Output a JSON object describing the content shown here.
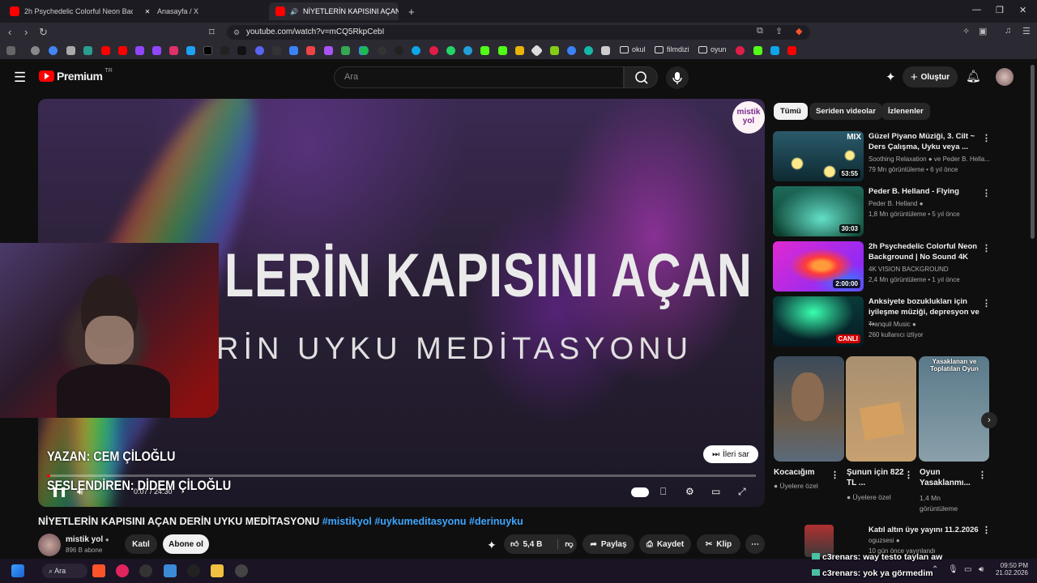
{
  "browser": {
    "tabs": [
      {
        "label": "2h Psychedelic Colorful Neon Backg",
        "icon": "youtube-icon"
      },
      {
        "label": "Anasayfa / X",
        "icon": "x-icon"
      },
      {
        "label": "NİYETLERİN KAPISINI AÇAN D",
        "icon": "youtube-icon"
      }
    ],
    "new_tab": "+",
    "url": "youtube.com/watch?v=mCQ5RkpCebI",
    "bookmark_folders": [
      "okul",
      "filmdizi",
      "oyun"
    ]
  },
  "header": {
    "logo_text": "Premium",
    "logo_sup": "TR",
    "search_placeholder": "Ara",
    "create_label": "Oluştur"
  },
  "player": {
    "big_title": "LERİN KAPISINI AÇAN",
    "big_subtitle": "RİN UYKU MEDİTASYONU",
    "author": "YAZAN: CEM ÇİLOĞLU",
    "voice": "SESLENDİREN: DİDEM ÇİLOĞLU",
    "channel_logo": "mistik yol",
    "skip_label": "İleri sar",
    "time": "0:07 / 24:30",
    "progress": 0.005
  },
  "video": {
    "title": "NİYETLERİN KAPISINI AÇAN DERİN UYKU MEDİTASYONU",
    "tags": "#mistikyol #uykumeditasyonu #derinuyku",
    "channel_name": "mistik yol",
    "subscribers": "896 B abone",
    "join_label": "Katıl",
    "subscribe_label": "Abone ol",
    "likes": "5,4 B",
    "share_label": "Paylaş",
    "save_label": "Kaydet",
    "clip_label": "Klip"
  },
  "sidebar": {
    "chips": [
      "Tümü",
      "Seriden videolar",
      "İzlenenler"
    ],
    "recs": [
      {
        "title": "Güzel Piyano Müziği, 3. Cilt ~ Ders Çalışma, Uyku veya ...",
        "channel": "Soothing Relaxation",
        "channel_extra": "ve Peder B. Hella...",
        "meta": "79 Mn görüntüleme • 6 yıl önce",
        "duration": "53:55",
        "badge": "MIX"
      },
      {
        "title": "Peder B. Helland - Flying",
        "channel": "Peder B. Helland",
        "meta": "1,8 Mn görüntüleme • 5 yıl önce",
        "duration": "30:03"
      },
      {
        "title": "2h Psychedelic Colorful Neon Background | No Sound 4K",
        "channel": "4K VISION BACKGROUND",
        "meta": "2,4 Mn görüntüleme • 1 yıl önce",
        "duration": "2:00:00"
      },
      {
        "title": "Anksiyete bozuklukları için iyileşme müziği, depresyon ve ...",
        "channel": "Tranquil Music",
        "meta": "260 kullanıcı izliyor",
        "duration": "CANLI"
      }
    ],
    "shorts": [
      {
        "title": "Kocacığım",
        "meta": "Üyelere özel"
      },
      {
        "title": "Şunun için 822 TL ...",
        "meta": "Üyelere özel"
      },
      {
        "title": "Oyun Yasaklanmı...",
        "meta": "1,4 Mn görüntüleme",
        "overlay": "Yasaklanan ve Toplatılan Oyun"
      }
    ],
    "last": {
      "title": "Katıl altın üye yayını 11.2.2026",
      "channel": "oguzsesi",
      "meta": "10 gün önce yayınlandı"
    }
  },
  "overlay_chat": [
    {
      "user": "c3renars",
      "text": ": way testo taylan aw"
    },
    {
      "user": "c3renars",
      "text": ": yok ya görmedim"
    }
  ],
  "taskbar": {
    "search_label": "Ara",
    "time": "09:50 PM",
    "date": "21.02.2026"
  }
}
